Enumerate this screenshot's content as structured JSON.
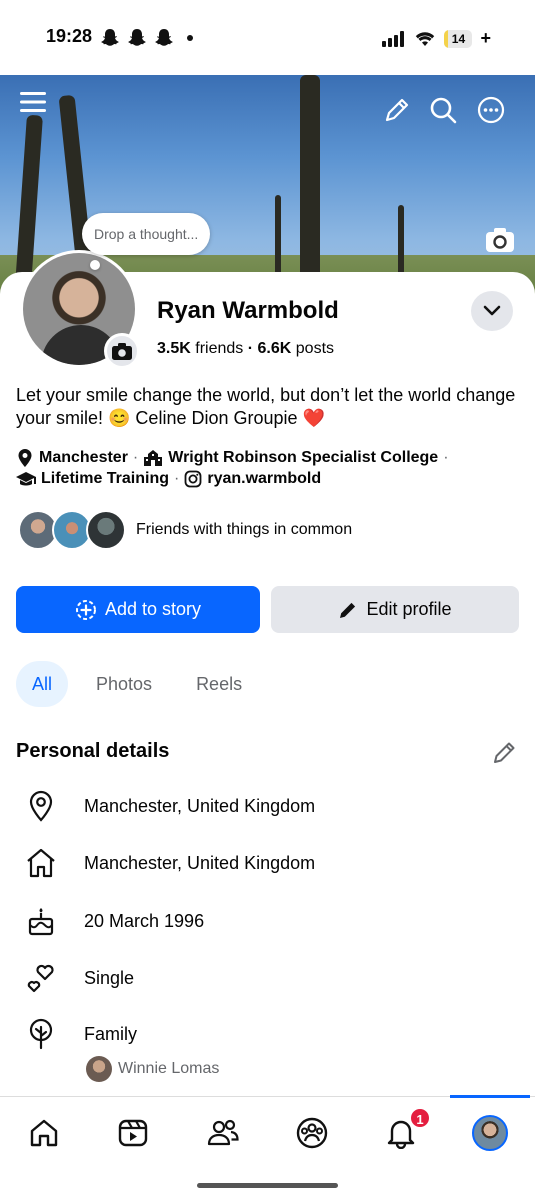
{
  "status_bar": {
    "time": "19:28",
    "battery": "14",
    "battery_level": 0.14,
    "plus": "+"
  },
  "cover": {
    "thought_placeholder": "Drop a thought..."
  },
  "profile": {
    "name": "Ryan Warmbold",
    "friends_count": "3.5K",
    "friends_label": "friends",
    "stats_separator": "·",
    "posts_count": "6.6K",
    "posts_label": "posts",
    "bio": "Let your smile change the world, but don’t let the world change your smile! 😊 Celine Dion Groupie",
    "bio_heart": "❤️",
    "intro": {
      "location": "Manchester",
      "school": "Wright Robinson Specialist College",
      "work": "Lifetime Training",
      "instagram": "ryan.warmbold",
      "separator": "·"
    },
    "friends_common": "Friends with things in common"
  },
  "buttons": {
    "add_story": "Add to story",
    "edit_profile": "Edit profile"
  },
  "tabs": [
    {
      "label": "All",
      "active": true
    },
    {
      "label": "Photos",
      "active": false
    },
    {
      "label": "Reels",
      "active": false
    }
  ],
  "personal_details": {
    "title": "Personal details",
    "items": [
      {
        "icon": "location-pin-icon",
        "text": "Manchester, United Kingdom"
      },
      {
        "icon": "home-icon",
        "text": "Manchester, United Kingdom"
      },
      {
        "icon": "birthday-cake-icon",
        "text": "20 March 1996"
      },
      {
        "icon": "hearts-icon",
        "text": "Single"
      },
      {
        "icon": "family-tree-icon",
        "text": "Family"
      }
    ],
    "family_member": "Winnie Lomas"
  },
  "nav": {
    "notifications_badge": "1"
  },
  "colors": {
    "accent": "#0866ff",
    "badge": "#e41e3f",
    "secondary_bg": "#e4e6eb"
  }
}
